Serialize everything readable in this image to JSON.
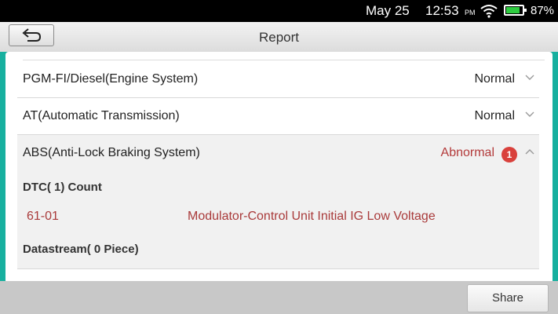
{
  "status_bar": {
    "date": "May 25",
    "time": "12:53",
    "ampm": "PM",
    "battery": "87%",
    "battery_fraction": 0.87,
    "icons": [
      "wifi-icon",
      "battery-icon"
    ]
  },
  "header": {
    "title": "Report",
    "back_icon": "back-arrow-icon"
  },
  "systems": [
    {
      "name": "PGM-FI/Diesel(Engine System)",
      "status": "Normal",
      "expanded": false
    },
    {
      "name": "AT(Automatic Transmission)",
      "status": "Normal",
      "expanded": false
    },
    {
      "name": "ABS(Anti-Lock Braking System)",
      "status": "Abnormal",
      "badge": "1",
      "expanded": true
    }
  ],
  "abs_detail": {
    "dtc_heading": "DTC( 1) Count",
    "codes": [
      {
        "code": "61-01",
        "description": "Modulator-Control Unit Initial IG Low Voltage"
      }
    ],
    "datastream_heading": "Datastream( 0 Piece)"
  },
  "footer": {
    "share_label": "Share"
  },
  "colors": {
    "accent": "#17b09f",
    "abnormal": "#b33a3a",
    "badge": "#d9413c"
  }
}
